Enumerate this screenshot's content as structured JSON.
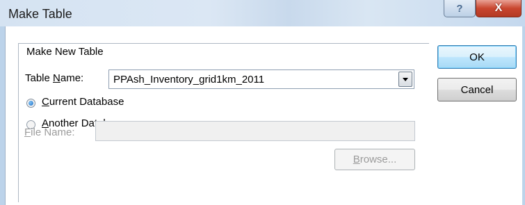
{
  "window": {
    "title": "Make Table",
    "help_glyph": "?",
    "close_glyph": "X"
  },
  "group": {
    "label": "Make New Table"
  },
  "table_name": {
    "label_pre": "Table ",
    "label_accel": "N",
    "label_post": "ame:",
    "value": "PPAsh_Inventory_grid1km_2011"
  },
  "radios": {
    "current": {
      "accel": "C",
      "rest": "urrent Database",
      "checked": true
    },
    "another": {
      "accel": "A",
      "rest": "nother Database:",
      "checked": false
    }
  },
  "file_name": {
    "accel": "F",
    "rest": "ile Name:",
    "value": ""
  },
  "buttons": {
    "ok": "OK",
    "cancel": "Cancel",
    "browse_accel": "B",
    "browse_rest": "rowse..."
  }
}
